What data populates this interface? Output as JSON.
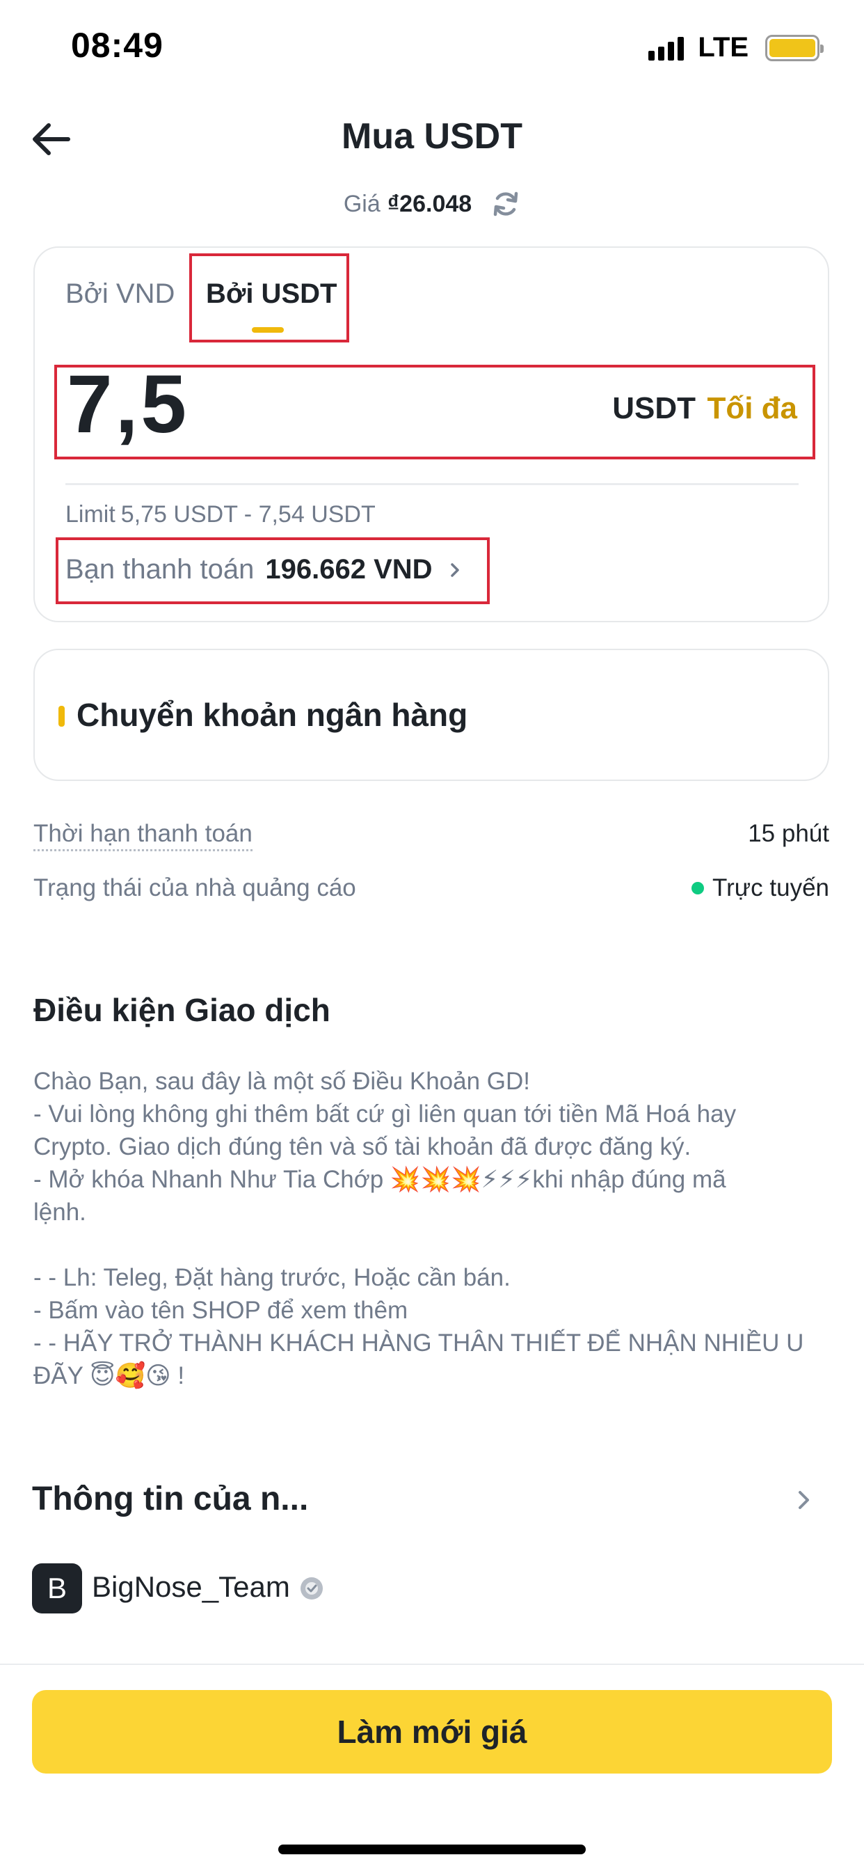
{
  "status_bar": {
    "time": "08:49",
    "network": "LTE"
  },
  "header": {
    "title": "Mua USDT",
    "price_label": "Giá",
    "price_value": "₫26.048"
  },
  "amount_card": {
    "tabs": [
      {
        "label": "Bởi VND",
        "active": false
      },
      {
        "label": "Bởi USDT",
        "active": true
      }
    ],
    "amount": "7,5",
    "unit": "USDT",
    "max_label": "Tối đa",
    "limit_label": "Limit",
    "limit_value": "5,75 USDT - 7,54 USDT",
    "pay_label": "Bạn thanh toán",
    "pay_value": "196.662 VND"
  },
  "payment_method": {
    "label": "Chuyển khoản ngân hàng"
  },
  "info_rows": {
    "deadline_label": "Thời hạn thanh toán",
    "deadline_value": "15 phút",
    "advertiser_status_label": "Trạng thái của nhà quảng cáo",
    "advertiser_status_value": "Trực tuyến"
  },
  "terms": {
    "title": "Điều kiện Giao dịch",
    "lines": [
      "Chào Bạn, sau đây là một số Điều Khoản GD!",
      "- Vui lòng không ghi thêm bất cứ gì liên quan tới tiền Mã Hoá hay",
      "Crypto. Giao dịch đúng tên và số tài khoản đã được đăng ký.",
      "- Mở khóa Nhanh Như Tia Chớp 💥💥💥⚡⚡⚡khi nhập đúng mã",
      "lệnh.",
      "",
      "- - Lh: Teleg, Đặt hàng trước, Hoặc cần bán.",
      "- Bấm vào tên SHOP để xem thêm",
      "- - HÃY TRỞ THÀNH KHÁCH HÀNG THÂN THIẾT ĐỂ NHẬN NHIỀU U",
      "ĐÃY 😇🥰😘 !"
    ]
  },
  "advertiser": {
    "section_title": "Thông tin của n...",
    "avatar_letter": "B",
    "name": "BigNose_Team"
  },
  "cta": {
    "label": "Làm mới giá"
  },
  "colors": {
    "brand_yellow": "#FCD535",
    "accent_gold": "#C99400",
    "online_green": "#0ECB81",
    "highlight_red": "#D9283A"
  }
}
